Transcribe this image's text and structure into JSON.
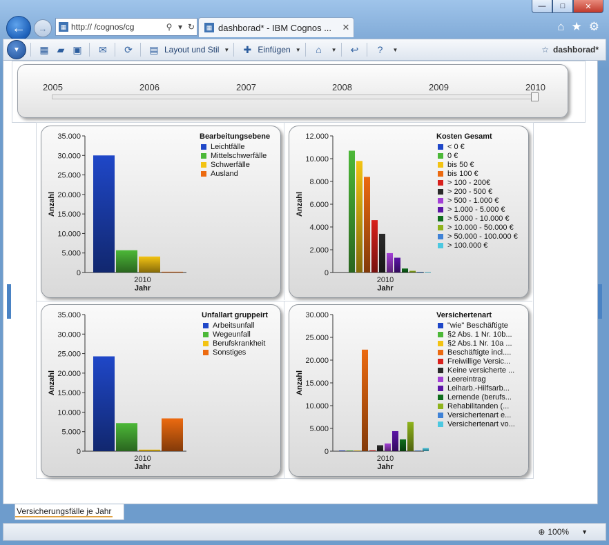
{
  "window": {
    "caption_buttons": [
      "—",
      "□",
      "✕"
    ]
  },
  "browser": {
    "back_glyph": "←",
    "forward_glyph": "→",
    "address": "http://        /cognos/cg",
    "address_icons": [
      "search-icon",
      "refresh-icon"
    ],
    "tab_title": "dashborad* - IBM Cognos ...",
    "tab_close": "✕",
    "right_icons": [
      "home-icon",
      "star-icon",
      "gear-icon"
    ]
  },
  "toolbar": {
    "layout_label": "Layout und Stil",
    "insert_label": "Einfügen",
    "doc_title": "dashborad*"
  },
  "slider": {
    "years": [
      "2005",
      "2006",
      "2007",
      "2008",
      "2009",
      "2010"
    ],
    "selected": "2010"
  },
  "charts": {
    "c1": {
      "legend_title": "Bearbeitungsebene",
      "legend": [
        "Leichtfälle",
        "Mittelschwerfälle",
        "Schwerfälle",
        "Ausland"
      ],
      "ylabel": "Anzahl",
      "xlabel": "Jahr",
      "category": "2010"
    },
    "c2": {
      "legend_title": "Kosten Gesamt",
      "legend": [
        "< 0 €",
        "0 €",
        "bis 50 €",
        "bis 100 €",
        "> 100 - 200€",
        "> 200 - 500 €",
        "> 500 - 1.000 €",
        "> 1.000 - 5.000 €",
        "> 5.000 - 10.000 €",
        "> 10.000 - 50.000 €",
        "> 50.000 - 100.000 €",
        "> 100.000 €"
      ],
      "ylabel": "Anzahl",
      "xlabel": "Jahr",
      "category": "2010"
    },
    "c3": {
      "legend_title": "Unfallart gruppeirt",
      "legend": [
        "Arbeitsunfall",
        "Wegeunfall",
        "Berufskrankheit",
        "Sonstiges"
      ],
      "ylabel": "Anzahl",
      "xlabel": "Jahr",
      "category": "2010"
    },
    "c4": {
      "legend_title": "Versichertenart",
      "legend": [
        "\"wie\" Beschäftigte",
        "§2 Abs. 1 Nr. 10b...",
        "§2 Abs.1 Nr. 10a ...",
        "Beschäftigte incl....",
        "Freiwillige Versic...",
        "Keine versicherte ...",
        "Leereintrag",
        "Leiharb.-Hilfsarb...",
        "Lernende (berufs...",
        "Rehabilitanden (...",
        "Versichertenart e...",
        "Versichertenart vo..."
      ],
      "ylabel": "Anzahl",
      "xlabel": "Jahr",
      "category": "2010"
    }
  },
  "chart_data": [
    {
      "type": "bar",
      "legend_title": "Bearbeitungsebene",
      "categories": [
        "2010"
      ],
      "series": [
        {
          "name": "Leichtfälle",
          "values": [
            30000
          ],
          "color": "#1f47c8"
        },
        {
          "name": "Mittelschwerfälle",
          "values": [
            5700
          ],
          "color": "#4cb838"
        },
        {
          "name": "Schwerfälle",
          "values": [
            4100
          ],
          "color": "#f3c313"
        },
        {
          "name": "Ausland",
          "values": [
            200
          ],
          "color": "#ec6a10"
        }
      ],
      "xlabel": "Jahr",
      "ylabel": "Anzahl",
      "yticks": [
        "0",
        "5.000",
        "10.000",
        "15.000",
        "20.000",
        "25.000",
        "30.000",
        "35.000"
      ],
      "ylim": [
        0,
        35000
      ],
      "legend_position": "right"
    },
    {
      "type": "bar",
      "legend_title": "Kosten Gesamt",
      "categories": [
        "2010"
      ],
      "series": [
        {
          "name": "< 0 €",
          "values": [
            0
          ],
          "color": "#1f47c8"
        },
        {
          "name": "0 €",
          "values": [
            10700
          ],
          "color": "#4cb838"
        },
        {
          "name": "bis 50 €",
          "values": [
            9800
          ],
          "color": "#f3c313"
        },
        {
          "name": "bis 100 €",
          "values": [
            8400
          ],
          "color": "#ec6a10"
        },
        {
          "name": "> 100 - 200€",
          "values": [
            4600
          ],
          "color": "#d8201c"
        },
        {
          "name": "> 200 - 500 €",
          "values": [
            3400
          ],
          "color": "#2a2a2a"
        },
        {
          "name": "> 500 - 1.000 €",
          "values": [
            1700
          ],
          "color": "#a33fd6"
        },
        {
          "name": "> 1.000 - 5.000 €",
          "values": [
            1300
          ],
          "color": "#5b14a6"
        },
        {
          "name": "> 5.000 - 10.000 €",
          "values": [
            350
          ],
          "color": "#0f6e1c"
        },
        {
          "name": "> 10.000 - 50.000 €",
          "values": [
            150
          ],
          "color": "#8fb31c"
        },
        {
          "name": "> 50.000 - 100.000 €",
          "values": [
            50
          ],
          "color": "#3f82d6"
        },
        {
          "name": "> 100.000 €",
          "values": [
            30
          ],
          "color": "#4cc8e0"
        }
      ],
      "xlabel": "Jahr",
      "ylabel": "Anzahl",
      "yticks": [
        "0",
        "2.000",
        "4.000",
        "6.000",
        "8.000",
        "10.000",
        "12.000"
      ],
      "ylim": [
        0,
        12000
      ],
      "legend_position": "right"
    },
    {
      "type": "bar",
      "legend_title": "Unfallart gruppeirt",
      "categories": [
        "2010"
      ],
      "series": [
        {
          "name": "Arbeitsunfall",
          "values": [
            24300
          ],
          "color": "#1f47c8"
        },
        {
          "name": "Wegeunfall",
          "values": [
            7200
          ],
          "color": "#4cb838"
        },
        {
          "name": "Berufskrankheit",
          "values": [
            400
          ],
          "color": "#f3c313"
        },
        {
          "name": "Sonstiges",
          "values": [
            8400
          ],
          "color": "#ec6a10"
        }
      ],
      "xlabel": "Jahr",
      "ylabel": "Anzahl",
      "yticks": [
        "0",
        "5.000",
        "10.000",
        "15.000",
        "20.000",
        "25.000",
        "30.000",
        "35.000"
      ],
      "ylim": [
        0,
        35000
      ],
      "legend_position": "right"
    },
    {
      "type": "bar",
      "legend_title": "Versichertenart",
      "categories": [
        "2010"
      ],
      "series": [
        {
          "name": "\"wie\" Beschäftigte",
          "values": [
            100
          ],
          "color": "#1f47c8"
        },
        {
          "name": "§2 Abs. 1 Nr. 10b...",
          "values": [
            100
          ],
          "color": "#4cb838"
        },
        {
          "name": "§2 Abs.1 Nr. 10a ...",
          "values": [
            100
          ],
          "color": "#f3c313"
        },
        {
          "name": "Beschäftigte incl....",
          "values": [
            22300
          ],
          "color": "#ec6a10"
        },
        {
          "name": "Freiwillige Versic...",
          "values": [
            200
          ],
          "color": "#d8201c"
        },
        {
          "name": "Keine versicherte ...",
          "values": [
            1300
          ],
          "color": "#2a2a2a"
        },
        {
          "name": "Leereintrag",
          "values": [
            1700
          ],
          "color": "#a33fd6"
        },
        {
          "name": "Leiharb.-Hilfsarb...",
          "values": [
            4400
          ],
          "color": "#5b14a6"
        },
        {
          "name": "Lernende (berufs...",
          "values": [
            2600
          ],
          "color": "#0f6e1c"
        },
        {
          "name": "Rehabilitanden (...",
          "values": [
            6400
          ],
          "color": "#8fb31c"
        },
        {
          "name": "Versichertenart e...",
          "values": [
            100
          ],
          "color": "#3f82d6"
        },
        {
          "name": "Versichertenart vo...",
          "values": [
            700
          ],
          "color": "#4cc8e0"
        }
      ],
      "xlabel": "Jahr",
      "ylabel": "Anzahl",
      "yticks": [
        "0",
        "5.000",
        "10.000",
        "15.000",
        "20.000",
        "25.000",
        "30.000"
      ],
      "ylim": [
        0,
        30000
      ],
      "legend_position": "right"
    }
  ],
  "bottom_tab": "Versicherungsfälle je Jahr",
  "status": {
    "zoom": "100%"
  }
}
